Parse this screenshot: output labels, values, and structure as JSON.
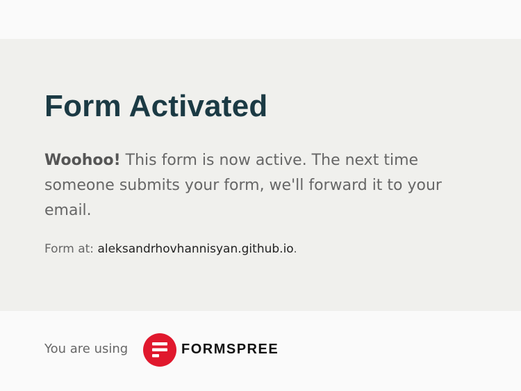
{
  "panel": {
    "title": "Form Activated",
    "message_lead": "Woohoo!",
    "message_body": " This form is now active. The next time someone submits your form, we'll forward it to your email.",
    "form_at_label": "Form at: ",
    "form_at_domain": "aleksandrhovhannisyan.github.io",
    "form_at_period": "."
  },
  "footer": {
    "using_text": "You are using",
    "brand_name": "FORMSPREE",
    "logo_icon": "formspree-logo-icon",
    "logo_color": "#e0182d"
  }
}
